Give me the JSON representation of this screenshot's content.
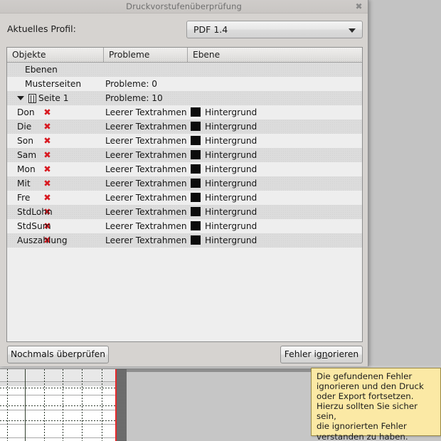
{
  "window": {
    "title": "Druckvorstufenüberprüfung",
    "close_icon": "close-icon",
    "close_glyph": "✖"
  },
  "profile": {
    "label": "Aktuelles Profil:",
    "selected": "PDF 1.4",
    "options": [
      "PDF 1.4"
    ],
    "chevron_icon": "chevron-down-icon"
  },
  "tree": {
    "columns": [
      "Objekte",
      "Probleme",
      "Ebene"
    ],
    "rows": [
      {
        "type": "group",
        "objekte": "Ebenen",
        "probleme": "",
        "ebene": "",
        "swatch": false,
        "error": false,
        "expander": false,
        "page_icon": false,
        "indent": 1
      },
      {
        "type": "group",
        "objekte": "Musterseiten",
        "probleme": "Probleme: 0",
        "ebene": "",
        "swatch": false,
        "error": false,
        "expander": false,
        "page_icon": false,
        "indent": 1
      },
      {
        "type": "page",
        "objekte": "Seite 1",
        "probleme": "Probleme: 10",
        "ebene": "",
        "swatch": false,
        "error": false,
        "expander": true,
        "page_icon": true,
        "indent": 3
      },
      {
        "type": "item",
        "objekte": "Don",
        "probleme": "Leerer Textrahmen",
        "ebene": "Hintergrund",
        "swatch": true,
        "error": true,
        "expander": false,
        "page_icon": false,
        "indent": 2
      },
      {
        "type": "item",
        "objekte": "Die",
        "probleme": "Leerer Textrahmen",
        "ebene": "Hintergrund",
        "swatch": true,
        "error": true,
        "expander": false,
        "page_icon": false,
        "indent": 2
      },
      {
        "type": "item",
        "objekte": "Son",
        "probleme": "Leerer Textrahmen",
        "ebene": "Hintergrund",
        "swatch": true,
        "error": true,
        "expander": false,
        "page_icon": false,
        "indent": 2
      },
      {
        "type": "item",
        "objekte": "Sam",
        "probleme": "Leerer Textrahmen",
        "ebene": "Hintergrund",
        "swatch": true,
        "error": true,
        "expander": false,
        "page_icon": false,
        "indent": 2
      },
      {
        "type": "item",
        "objekte": "Mon",
        "probleme": "Leerer Textrahmen",
        "ebene": "Hintergrund",
        "swatch": true,
        "error": true,
        "expander": false,
        "page_icon": false,
        "indent": 2
      },
      {
        "type": "item",
        "objekte": "Mit",
        "probleme": "Leerer Textrahmen",
        "ebene": "Hintergrund",
        "swatch": true,
        "error": true,
        "expander": false,
        "page_icon": false,
        "indent": 2
      },
      {
        "type": "item",
        "objekte": "Fre",
        "probleme": "Leerer Textrahmen",
        "ebene": "Hintergrund",
        "swatch": true,
        "error": true,
        "expander": false,
        "page_icon": false,
        "indent": 2
      },
      {
        "type": "item",
        "objekte": "StdLohn",
        "probleme": "Leerer Textrahmen",
        "ebene": "Hintergrund",
        "swatch": true,
        "error": true,
        "expander": false,
        "page_icon": false,
        "indent": 2
      },
      {
        "type": "item",
        "objekte": "StdSum",
        "probleme": "Leerer Textrahmen",
        "ebene": "Hintergrund",
        "swatch": true,
        "error": true,
        "expander": false,
        "page_icon": false,
        "indent": 2
      },
      {
        "type": "item",
        "objekte": "Auszahlung",
        "probleme": "Leerer Textrahmen",
        "ebene": "Hintergrund",
        "swatch": true,
        "error": true,
        "expander": false,
        "page_icon": false,
        "indent": 2
      }
    ],
    "error_glyph": "✖",
    "error_color": "#d81920",
    "swatch_color": "#0c0c0c"
  },
  "footer": {
    "recheck_label": "Nochmals überprüfen",
    "ignore_label_pre": "Fehler ig",
    "ignore_label_mnemonic": "n",
    "ignore_label_post": "orieren"
  },
  "tooltip": {
    "text": "Die gefundenen Fehler\nignorieren und den Druck\noder Export fortsetzen.\nHierzu sollten Sie sicher sein,\ndie ignorierten Fehler\nverstanden zu haben.",
    "background": "#fbe9a5",
    "border": "#9a8a46"
  },
  "canvas": {
    "margin_guide_color": "#e8292b",
    "grid_color": "#33402f"
  }
}
